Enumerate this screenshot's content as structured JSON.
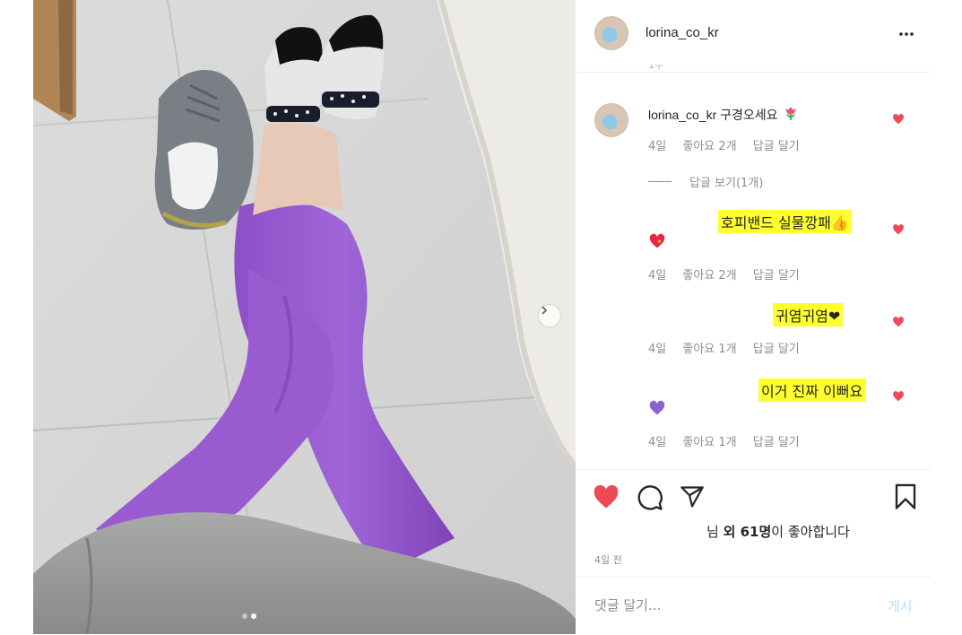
{
  "post": {
    "username": "lorina_co_kr",
    "image_alt": "Legs in purple leggings and black and white socks on a tiled floor, sneakers nearby",
    "carousel": {
      "current": 2,
      "total": 2
    }
  },
  "comments": {
    "first": {
      "username": "lorina_co_kr",
      "text": "구경오세요",
      "emoji": "tulip-icon",
      "time": "4일",
      "likes": "좋아요 2개",
      "reply": "답글 달기"
    },
    "view_replies": "답글 보기(1개)",
    "replies": [
      {
        "text": "호피밴드 실물깡패👍",
        "emoji": "sparkling-heart-icon",
        "time": "4일",
        "likes": "좋아요 2개",
        "reply": "답글 달기"
      },
      {
        "text": "귀염귀염❤",
        "time": "4일",
        "likes": "좋아요 1개",
        "reply": "답글 달기"
      },
      {
        "text": "이거 진짜 이뻐요",
        "emoji": "purple-heart-icon",
        "time": "4일",
        "likes": "좋아요 1개",
        "reply": "답글 달기"
      }
    ]
  },
  "likes_line": {
    "prefix": "님 ",
    "bold": "외 61명",
    "suffix": "이 좋아합니다"
  },
  "posted": "4일 전",
  "composer": {
    "placeholder": "댓글 달기...",
    "post_label": "게시"
  },
  "colors": {
    "like_red": "#ed4956",
    "highlight": "#ffff2e",
    "post_blue": "#b3dffc",
    "legging_purple": "#9b59d0"
  }
}
